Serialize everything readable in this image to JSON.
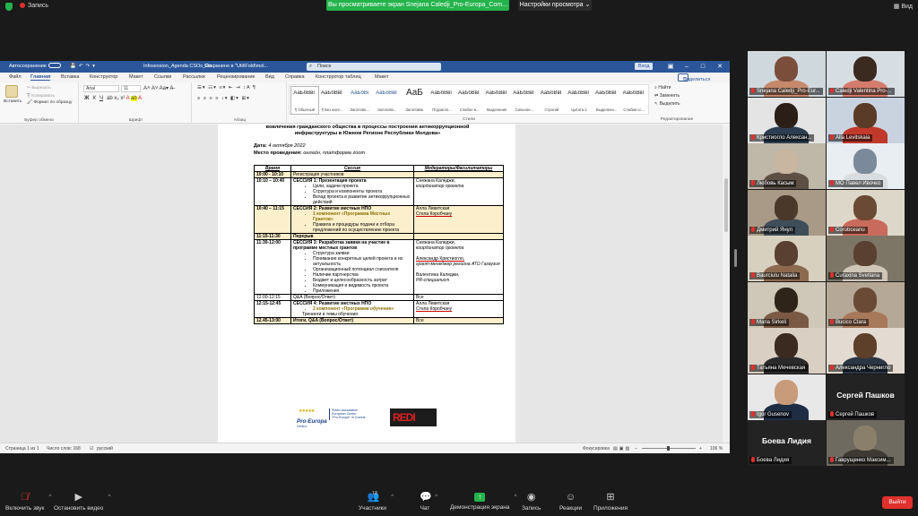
{
  "topbar": {
    "recording_label": "Запись",
    "share_banner": "Вы просматриваете экран Snejana Caledji_Pro-Europa_Com...",
    "view_options": "Настройки просмотра ⌄",
    "view_label": "Вид"
  },
  "word": {
    "autosave_label": "Автосохранение",
    "doc_title": "Infosession_Agenda CSOs_Ro...",
    "saved_status": "Сохранено в \"Util\\Fold\\mol...",
    "search_placeholder": "Поиск",
    "sign_in": "Вход",
    "menu": [
      "Файл",
      "Главная",
      "Вставка",
      "Конструктор",
      "Макет",
      "Ссылки",
      "Рассылки",
      "Рецензирование",
      "Вид",
      "Справка",
      "Конструктор таблиц",
      "Макет"
    ],
    "share_label": "Поделиться",
    "ribbon": {
      "paste": "Вставить",
      "cut": "Вырезать",
      "copy": "Копировать",
      "format_painter": "Формат по образцу",
      "clipboard": "Буфер обмена",
      "font_name": "Arial",
      "font_size": "11",
      "font_group": "Шрифт",
      "paragraph_group": "Абзац",
      "styles_group": "Стили",
      "edit_group": "Редактирование",
      "find": "Найти",
      "replace": "Заменить",
      "select": "Выделить",
      "styles": [
        {
          "sample": "АаБбВвГ",
          "name": "¶ Обычный"
        },
        {
          "sample": "АаБбВвГ",
          "name": "¶ Без инте..."
        },
        {
          "sample": "АаБбВі",
          "name": "Заголово..."
        },
        {
          "sample": "АаБбВвГ",
          "name": "Заголово..."
        },
        {
          "sample": "АаБ",
          "name": "Заголовок"
        },
        {
          "sample": "АаБбВвГ",
          "name": "Подзагол..."
        },
        {
          "sample": "АаБбВвГ",
          "name": "Слабое в..."
        },
        {
          "sample": "АаБбВвГ",
          "name": "Выделение"
        },
        {
          "sample": "АаБбВвГ",
          "name": "Сильное..."
        },
        {
          "sample": "АаБбВвГ",
          "name": "Строгий"
        },
        {
          "sample": "АаБбВвГ",
          "name": "Цитата 2"
        },
        {
          "sample": "АаБбВвГ",
          "name": "Выделенн..."
        },
        {
          "sample": "АаБбВвГ",
          "name": "Слабая сс..."
        }
      ]
    },
    "document": {
      "title_line1": "вовлечения гражданского общества в процессы построения антикоррупционной",
      "title_line2": "инфраструктуры в Южном Регионе Республики Молдова»",
      "date_label": "Дата:",
      "date_value": "4 октября 2022",
      "place_label": "Место проведения:",
      "place_value": "онлайн, платформа zoom",
      "headers": [
        "Время",
        "Сессия",
        "Модераторы/Фасилитаторы"
      ],
      "rows": {
        "r1": {
          "time": "10:00 - 10:10",
          "session": "Регистрация участников",
          "mod": ""
        },
        "r2": {
          "time": "10:10 – 10:40",
          "title": "СЕССИЯ 1: Презентация проекта",
          "b1": "Цели, задачи проекта",
          "b2": "Структура и компоненты проекта",
          "b3": "Вклад проекта в развитие антикоррупционных действий",
          "mod1": "Снежана Каледжи,",
          "mod2": "координатор проекта"
        },
        "r3": {
          "time": "10:40 – 11:15",
          "title": "СЕССИЯ 2: Развитие местных НПО",
          "b1": "1 компонент «Программа Местных Грантов»",
          "b2": "Правила и процедуры подачи и отбора предложений по осуществлению проекта",
          "mod1": "Алла Левитская",
          "mod2": "Стела Коробчану"
        },
        "r4": {
          "time": "11:15-11:30",
          "session": "Перерыв",
          "mod": ""
        },
        "r5": {
          "time": "11:30-12:00",
          "title": "СЕССИЯ 3: Разработка заявки на участие в программе местных грантов",
          "b1": "Структура заявки",
          "b2": "Понимание конкретных целей проекта и их актуальность",
          "b3": "Организационный потенциал соискателя",
          "b4": "Наличие партнерства",
          "b5": "Бюджет и целесообразность затрат",
          "b6": "Коммуникация и видимость проекта",
          "b7": "Приложения",
          "mod1": "Снежана Каледжи,",
          "mod2": "координатор проекта",
          "mod3": "Александр Кристиогло,",
          "mod4": "грант-менеджер региона АТО Гагаузия",
          "mod5": "Валентина Каледжи,",
          "mod6": "PR-специалист"
        },
        "r6": {
          "time": "12:00-12:15",
          "session": "Q&A (Вопрос/Ответ)",
          "mod": "Все"
        },
        "r7": {
          "time": "12:15-12:45",
          "title": "СЕССИЯ 4: Развитие местных НПО",
          "b1": "2 компонент «Программа обучения»",
          "extra": "Тренинги и темы обучения",
          "mod1": "Алла Левитская",
          "mod2": "Стела Коробчану"
        },
        "r8": {
          "time": "12.45-13:00",
          "session": "Итоги, Q&A (Вопрос/Ответ)",
          "mod": "Все"
        }
      },
      "logo_left_name": "Pro-Europa",
      "logo_left_sub": "Centrul",
      "logo_left_text1": "Public Association",
      "logo_left_text2": "European Center",
      "logo_left_text3": "\"Pro-Europe\" in Comrat",
      "logo_right": "REDI"
    },
    "status": {
      "page": "Страница 1 из 1",
      "words": "Число слов: 168",
      "lang": "русский",
      "focus": "Фокусировка",
      "zoom": "106 %"
    }
  },
  "participants": [
    {
      "name": "Snejana Caledji_Pro-Eur...",
      "active": true
    },
    {
      "name": "Caledji Valentina Pro-..."
    },
    {
      "name": "Кристиогло Алексан..."
    },
    {
      "name": "Alla Levitskaia"
    },
    {
      "name": "Любовь Касым"
    },
    {
      "name": "МО Павел Ивочко"
    },
    {
      "name": "Дмитрий Янул"
    },
    {
      "name": "Corobceanu"
    },
    {
      "name": "Baurciulu Natalia"
    },
    {
      "name": "Curaxina Svetlana"
    },
    {
      "name": "Maria Sirkeli"
    },
    {
      "name": "Bucico Clara"
    },
    {
      "name": "Татьяна Мечевская"
    },
    {
      "name": "Александра Чернигло"
    },
    {
      "name": "Igor Gusenov"
    },
    {
      "name": "Сергей Пашков",
      "big": "Сергей Пашков"
    },
    {
      "name": "Боева Лидия",
      "big": "Боева Лидия"
    },
    {
      "name": "Гаврущенко Максим..."
    }
  ],
  "bottombar": {
    "unmute": "Включить звук",
    "start_video": "Остановить видео",
    "participants": "Участники",
    "participants_count": "18",
    "chat": "Чат",
    "share": "Демонстрация экрана",
    "record": "Запись",
    "reactions": "Реакции",
    "apps": "Приложения",
    "leave": "Выйти"
  }
}
